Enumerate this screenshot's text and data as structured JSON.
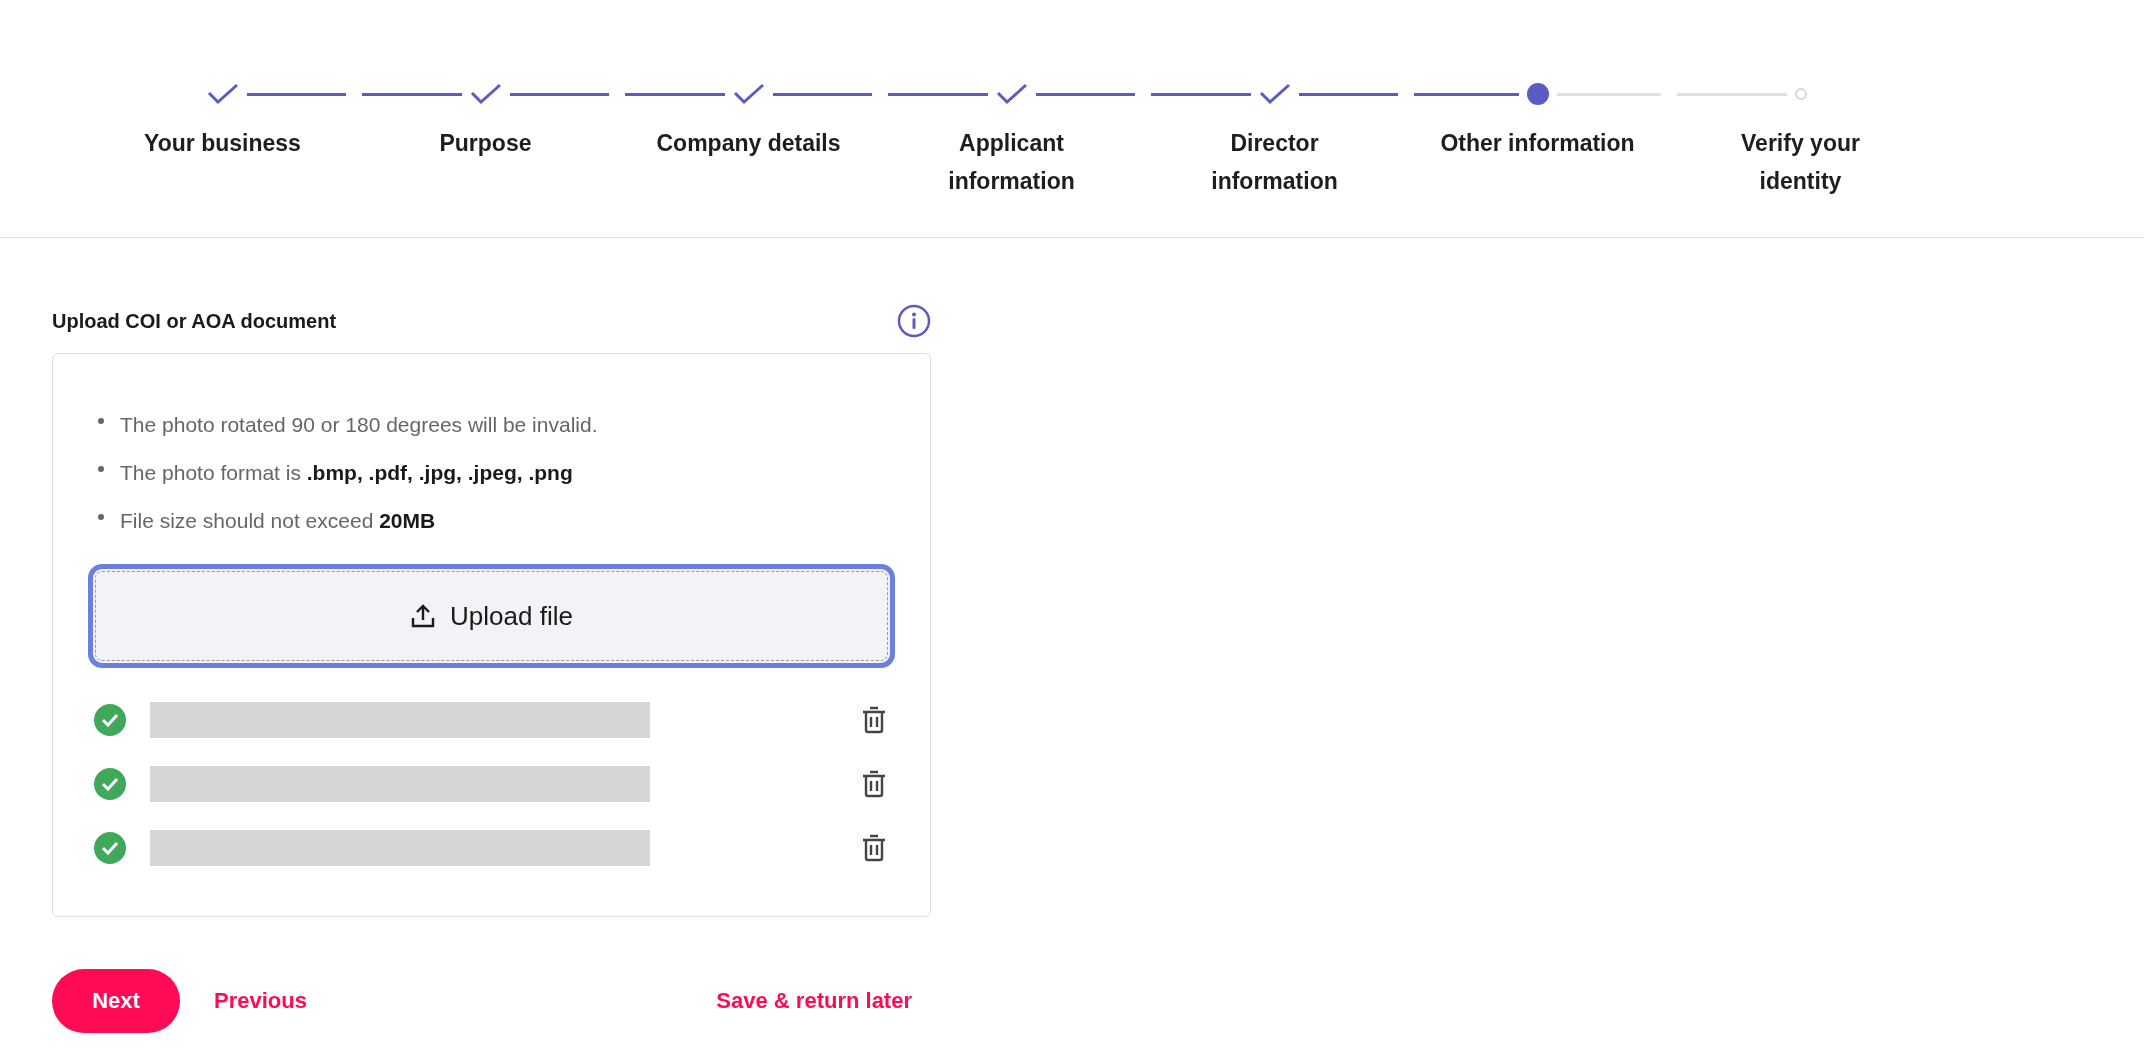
{
  "stepper": {
    "steps": [
      {
        "label": [
          "Your business"
        ],
        "done": true,
        "selected": false
      },
      {
        "label": [
          "Purpose"
        ],
        "done": true,
        "selected": false
      },
      {
        "label": [
          "Company details"
        ],
        "done": true,
        "selected": false
      },
      {
        "label": [
          "Applicant",
          "information"
        ],
        "done": true,
        "selected": false
      },
      {
        "label": [
          "Director",
          "information"
        ],
        "done": true,
        "selected": false
      },
      {
        "label": [
          "Other information"
        ],
        "done": false,
        "selected": true
      },
      {
        "label": [
          "Verify your",
          "identity"
        ],
        "done": false,
        "selected": false
      }
    ]
  },
  "upload": {
    "title": "Upload COI or AOA document",
    "rules": [
      "The photo rotated 90 or 180 degrees will be invalid.",
      "The photo format is **.bmp, .pdf, .jpg, .jpeg, .png**",
      "File size should not exceed **20MB**"
    ],
    "button": "Upload file",
    "files": [
      {
        "verified": true
      },
      {
        "verified": true
      },
      {
        "verified": true
      }
    ]
  },
  "actions": {
    "next": "Next",
    "previous": "Previous",
    "save": "Save & return later"
  }
}
